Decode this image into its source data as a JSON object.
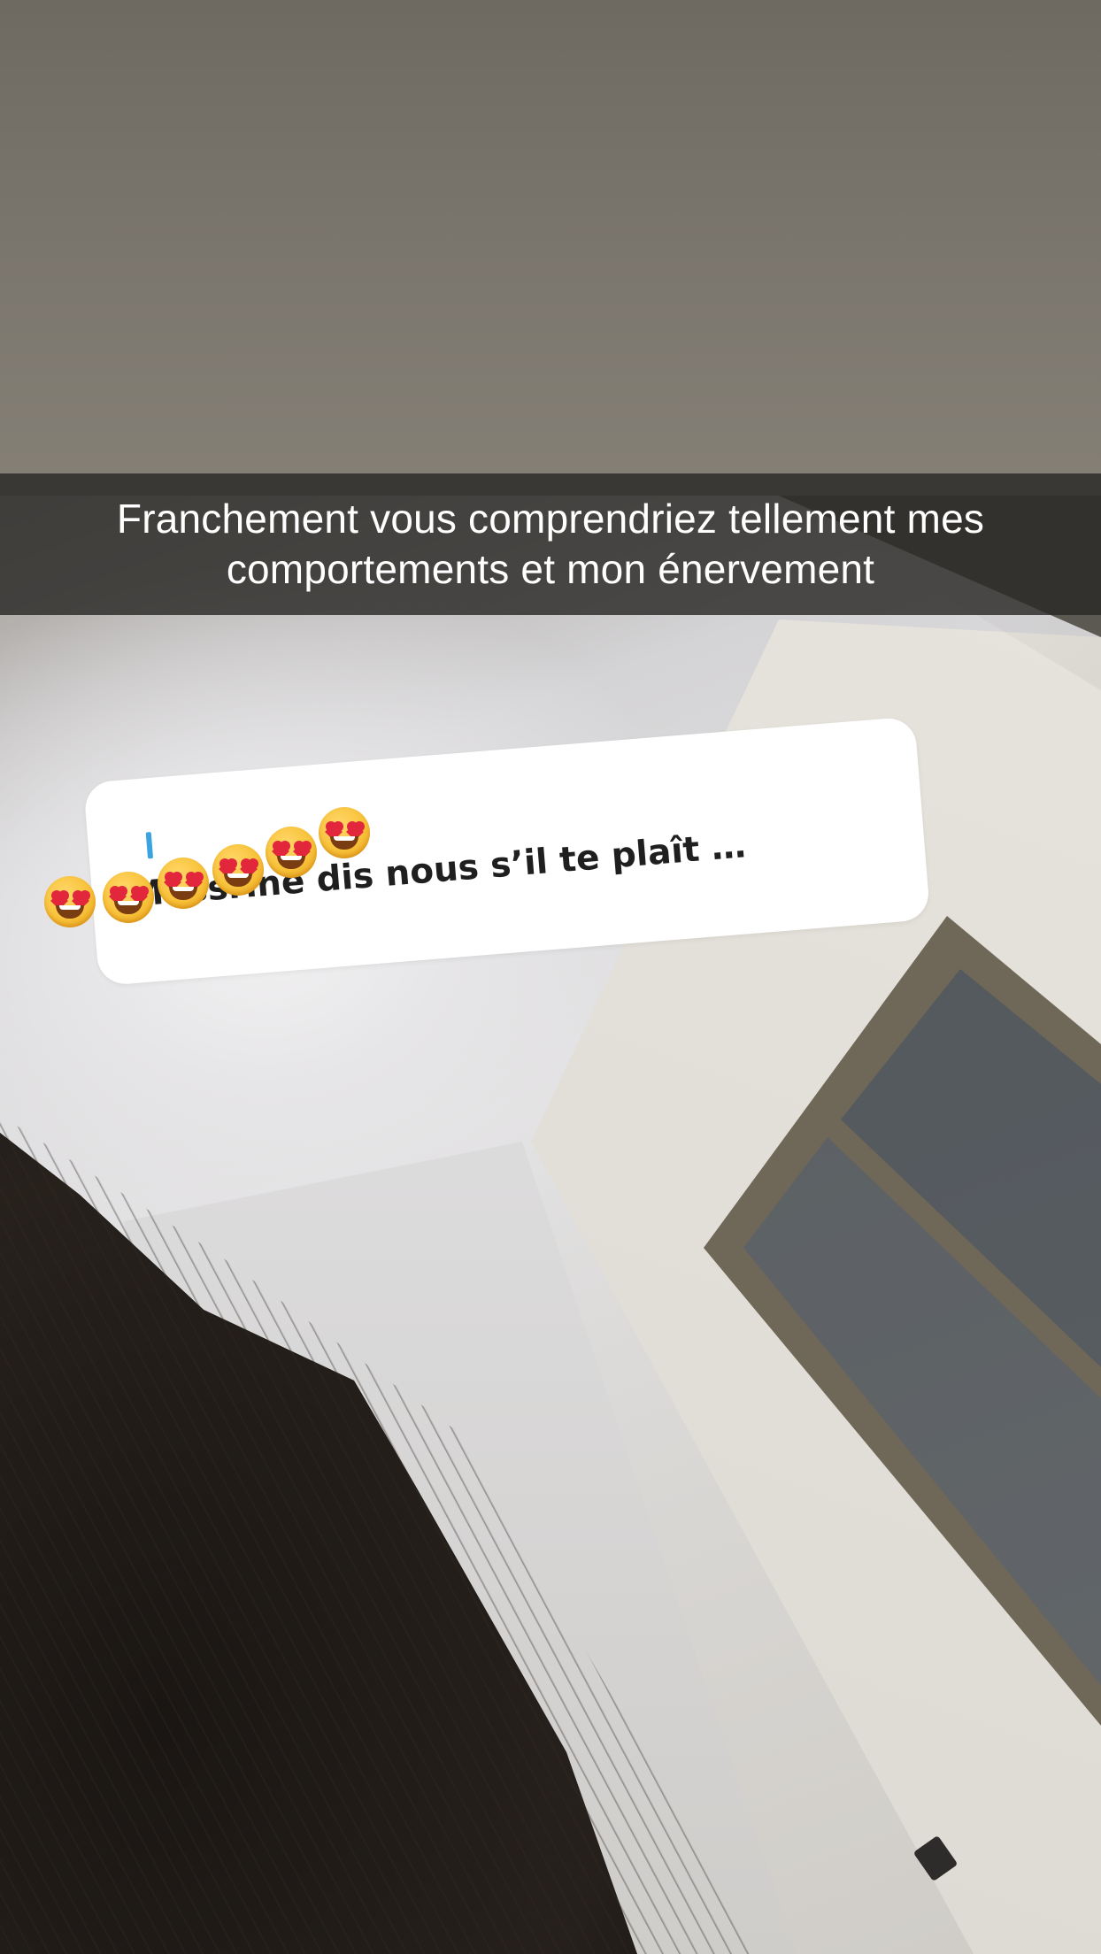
{
  "caption": {
    "text": "Franchement vous comprendriez tellement mes comportements et mon énervement"
  },
  "question_sticker": {
    "text": "Messrine dis nous s’il te plaît …"
  },
  "emojis": [
    {
      "icon": "heart-eyes-emoji-icon"
    },
    {
      "icon": "heart-eyes-emoji-icon"
    },
    {
      "icon": "heart-eyes-emoji-icon"
    },
    {
      "icon": "heart-eyes-emoji-icon"
    },
    {
      "icon": "heart-eyes-emoji-icon"
    },
    {
      "icon": "heart-eyes-emoji-icon"
    }
  ],
  "colors": {
    "caption_bar": "#2a2826",
    "sticker_background": "#ffffff",
    "sticker_accent": "#3aa3e0"
  }
}
